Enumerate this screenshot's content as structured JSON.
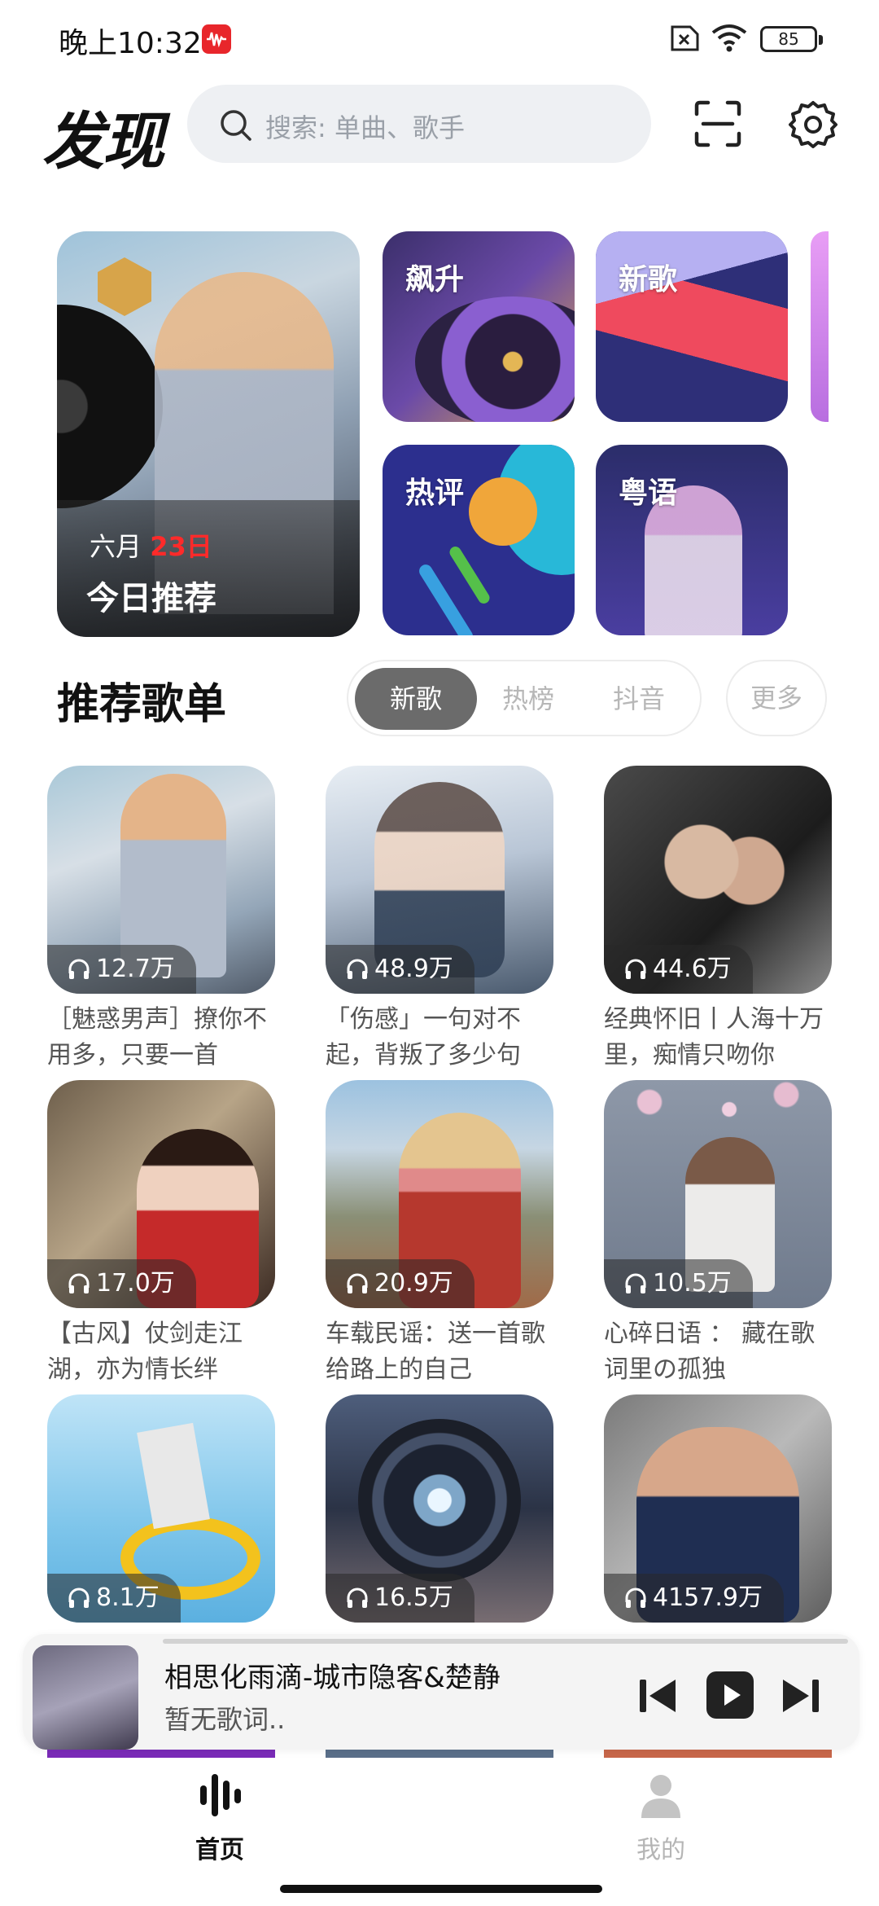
{
  "status_bar": {
    "time": "晚上10:32",
    "battery": "85"
  },
  "header": {
    "title": "发现",
    "search_placeholder": "搜索: 单曲、歌手"
  },
  "banners": {
    "hero": {
      "month": "六月",
      "day": "23日",
      "label": "今日推荐"
    },
    "tiles": [
      "飙升",
      "新歌",
      "热评",
      "粤语"
    ]
  },
  "section": {
    "title": "推荐歌单",
    "tabs": [
      "新歌",
      "热榜",
      "抖音"
    ],
    "active_tab": "新歌",
    "more": "更多"
  },
  "playlists": [
    {
      "plays": "12.7万",
      "title": "［魅惑男声］撩你不用多，只要一首"
    },
    {
      "plays": "48.9万",
      "title": "「伤感」一句对不起，背叛了多少句"
    },
    {
      "plays": "44.6万",
      "title": "经典怀旧丨人海十万里，痴情只吻你"
    },
    {
      "plays": "17.0万",
      "title": "【古风】仗剑走江湖，亦为情长绊"
    },
    {
      "plays": "20.9万",
      "title": "车载民谣：送一首歌给路上的自己"
    },
    {
      "plays": "10.5万",
      "title": "心碎日语 ： 藏在歌词里の孤独"
    },
    {
      "plays": "8.1万",
      "title": ""
    },
    {
      "plays": "16.5万",
      "title": ""
    },
    {
      "plays": "4157.9万",
      "title": ""
    }
  ],
  "player": {
    "title": "相思化雨滴-城市隐客&楚静",
    "lyric": "暂无歌词.."
  },
  "nav": {
    "home": "首页",
    "me": "我的"
  },
  "colors": {
    "accent_red": "#ff2a2a",
    "tab_active": "#6b6b6b"
  }
}
